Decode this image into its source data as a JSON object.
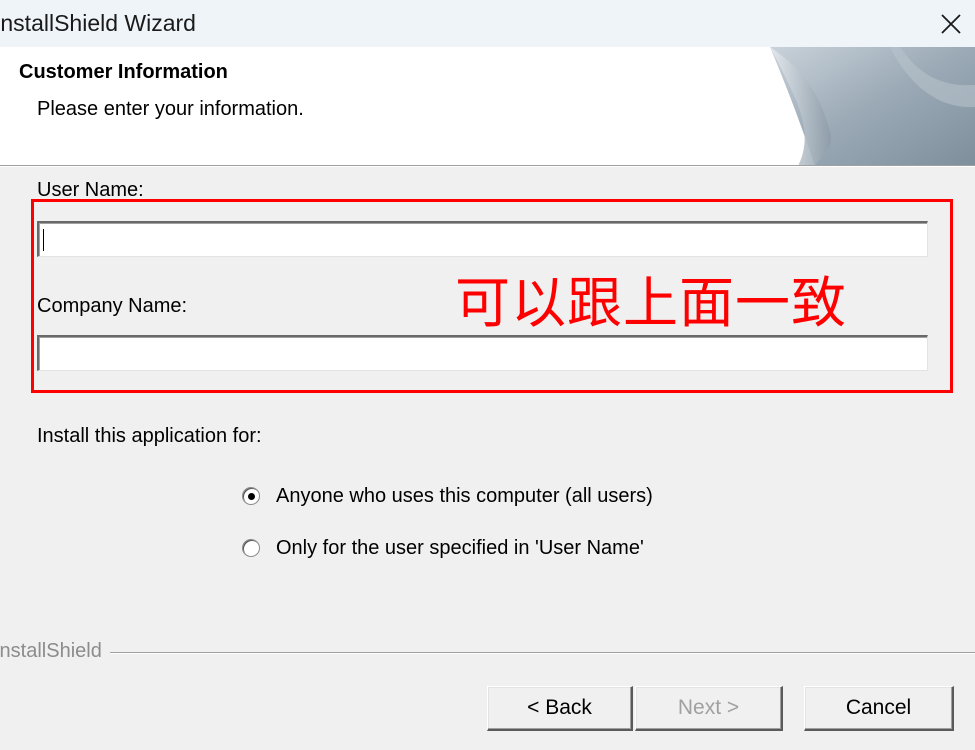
{
  "window": {
    "title": "InstallShield Wizard",
    "close_icon": "close-icon"
  },
  "header": {
    "title": "Customer Information",
    "subtitle": "Please enter your information."
  },
  "form": {
    "user_name_label": "User Name:",
    "user_name_value": "",
    "company_name_label": "Company Name:",
    "company_name_value": ""
  },
  "annotation": {
    "text": "可以跟上面一致",
    "color": "#ff0000"
  },
  "install_for": {
    "label": "Install this application for:",
    "options": [
      {
        "label": "Anyone who uses this computer (all users)",
        "selected": true
      },
      {
        "label": "Only for the user specified in 'User Name'",
        "selected": false
      }
    ]
  },
  "footer": {
    "brand": "InstallShield",
    "back_label": "< Back",
    "next_label": "Next >",
    "cancel_label": "Cancel"
  }
}
